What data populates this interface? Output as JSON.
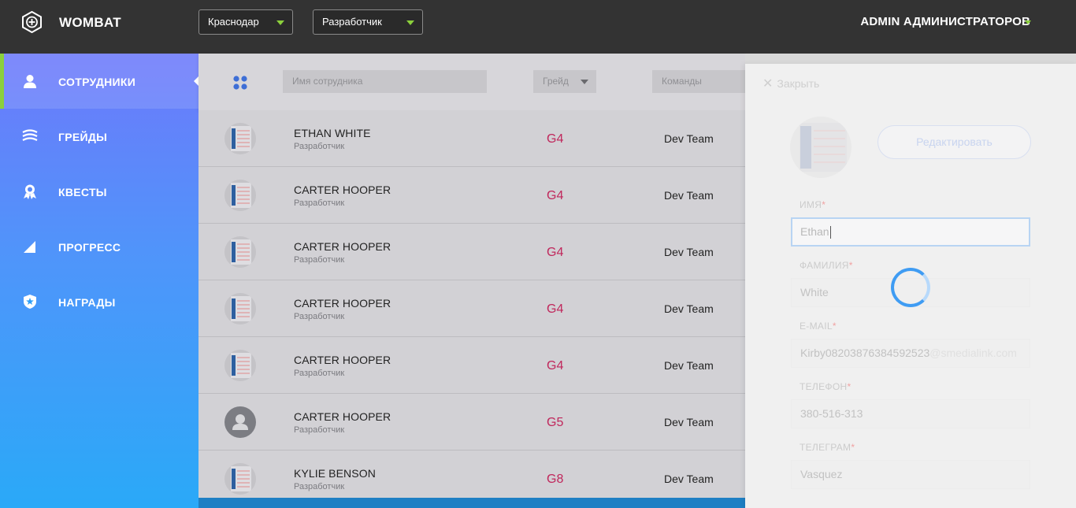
{
  "header": {
    "logo": "WOMBAT",
    "city_select": "Краснодар",
    "role_select": "Разработчик",
    "user": "ADMIN АДМИНИСТРАТОРОВ"
  },
  "sidebar": {
    "items": [
      {
        "label": "СОТРУДНИКИ",
        "icon": "user-icon",
        "active": true
      },
      {
        "label": "ГРЕЙДЫ",
        "icon": "layers-icon"
      },
      {
        "label": "КВЕСТЫ",
        "icon": "medal-icon"
      },
      {
        "label": "ПРОГРЕСС",
        "icon": "signal-icon"
      },
      {
        "label": "НАГРАДЫ",
        "icon": "star-badge-icon"
      }
    ]
  },
  "filters": {
    "name_placeholder": "Имя сотрудника",
    "grade_placeholder": "Грейд",
    "teams_placeholder": "Команды"
  },
  "employees": [
    {
      "name": "ETHAN WHITE",
      "role": "Разработчик",
      "grade": "G4",
      "team": "Dev Team",
      "avatar": "document"
    },
    {
      "name": "CARTER HOOPER",
      "role": "Разработчик",
      "grade": "G4",
      "team": "Dev Team",
      "avatar": "document"
    },
    {
      "name": "CARTER HOOPER",
      "role": "Разработчик",
      "grade": "G4",
      "team": "Dev Team",
      "avatar": "document"
    },
    {
      "name": "CARTER HOOPER",
      "role": "Разработчик",
      "grade": "G4",
      "team": "Dev Team",
      "avatar": "document"
    },
    {
      "name": "CARTER HOOPER",
      "role": "Разработчик",
      "grade": "G4",
      "team": "Dev Team",
      "avatar": "document"
    },
    {
      "name": "CARTER HOOPER",
      "role": "Разработчик",
      "grade": "G5",
      "team": "Dev Team",
      "avatar": "placeholder"
    },
    {
      "name": "KYLIE BENSON",
      "role": "Разработчик",
      "grade": "G8",
      "team": "Dev Team",
      "avatar": "document"
    }
  ],
  "panel": {
    "close": "Закрыть",
    "edit": "Редактировать",
    "fields": {
      "first_name": {
        "label": "ИМЯ",
        "value": "Ethan"
      },
      "last_name": {
        "label": "ФАМИЛИЯ",
        "value": "White"
      },
      "email": {
        "label": "E-MAIL",
        "value_local": "Kirby08203876384592523",
        "value_domain": "@smedialink.com"
      },
      "phone": {
        "label": "ТЕЛЕФОН",
        "value": "380-516-313"
      },
      "telegram": {
        "label": "ТЕЛЕГРАМ",
        "value": "Vasquez"
      }
    },
    "required_mark": "*"
  },
  "colors": {
    "accent_green": "#8bd03c",
    "grade_color": "#c0265b",
    "spinner": "#3f9cf3"
  }
}
